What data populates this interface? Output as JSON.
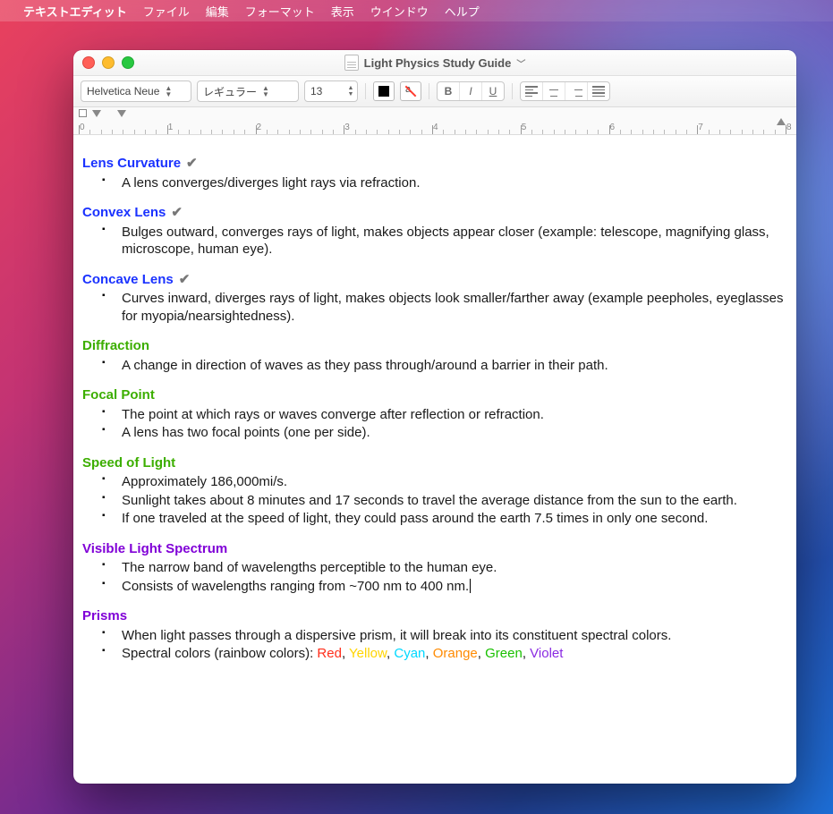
{
  "menubar": {
    "app": "テキストエディット",
    "items": [
      "ファイル",
      "編集",
      "フォーマット",
      "表示",
      "ウインドウ",
      "ヘルプ"
    ]
  },
  "window": {
    "title": "Light Physics Study Guide"
  },
  "toolbar": {
    "font": "Helvetica Neue",
    "style": "レギュラー",
    "size": "13",
    "bold": "B",
    "italic": "I",
    "underline": "U"
  },
  "ruler": {
    "labels": [
      "0",
      "1",
      "2",
      "3",
      "4",
      "5",
      "6",
      "7",
      "8"
    ]
  },
  "doc": {
    "sections": [
      {
        "id": "lens-curvature",
        "heading": "Lens Curvature",
        "color": "h-blue",
        "check": true,
        "items": [
          "A lens converges/diverges light rays via refraction."
        ]
      },
      {
        "id": "convex-lens",
        "heading": "Convex Lens",
        "color": "h-blue",
        "check": true,
        "items": [
          "Bulges outward, converges rays of light, makes objects appear closer (example: telescope, magnifying glass, microscope, human eye)."
        ]
      },
      {
        "id": "concave-lens",
        "heading": "Concave Lens",
        "color": "h-blue",
        "check": true,
        "items": [
          "Curves inward, diverges rays of light, makes objects look smaller/farther away (example peepholes, eyeglasses for myopia/nearsightedness)."
        ]
      },
      {
        "id": "diffraction",
        "heading": "Diffraction",
        "color": "h-green",
        "check": false,
        "items": [
          "A change in direction of waves as they pass through/around a barrier in their path."
        ]
      },
      {
        "id": "focal-point",
        "heading": "Focal Point",
        "color": "h-green",
        "check": false,
        "items": [
          "The point at which rays or waves converge after reflection or refraction.",
          "A lens has two focal points (one per side)."
        ]
      },
      {
        "id": "speed-of-light",
        "heading": "Speed of Light",
        "color": "h-green",
        "check": false,
        "items": [
          "Approximately 186,000mi/s.",
          "Sunlight takes about 8 minutes and 17 seconds to travel the average distance from the sun to the earth.",
          "If one traveled at the speed of light, they could pass around the earth 7.5 times in only one second."
        ]
      },
      {
        "id": "visible-light-spectrum",
        "heading": "Visible Light Spectrum",
        "color": "h-purple",
        "check": false,
        "items": [
          "The narrow band of wavelengths perceptible to the human eye.",
          "Consists of wavelengths ranging from ~700 nm to 400 nm."
        ],
        "caretAfterItemIndex": 1
      },
      {
        "id": "prisms",
        "heading": "Prisms",
        "color": "h-purple",
        "check": false,
        "items": [
          "When light passes through a dispersive prism, it will break into its constituent spectral colors."
        ],
        "rainbow": {
          "prefix": "Spectral colors (rainbow colors): ",
          "words": [
            {
              "t": "Red",
              "c": "c-red"
            },
            {
              "t": "Yellow",
              "c": "c-yel"
            },
            {
              "t": "Cyan",
              "c": "c-cyan"
            },
            {
              "t": "Orange",
              "c": "c-or"
            },
            {
              "t": "Green",
              "c": "c-grn"
            },
            {
              "t": "Violet",
              "c": "c-vio"
            }
          ]
        }
      }
    ]
  }
}
